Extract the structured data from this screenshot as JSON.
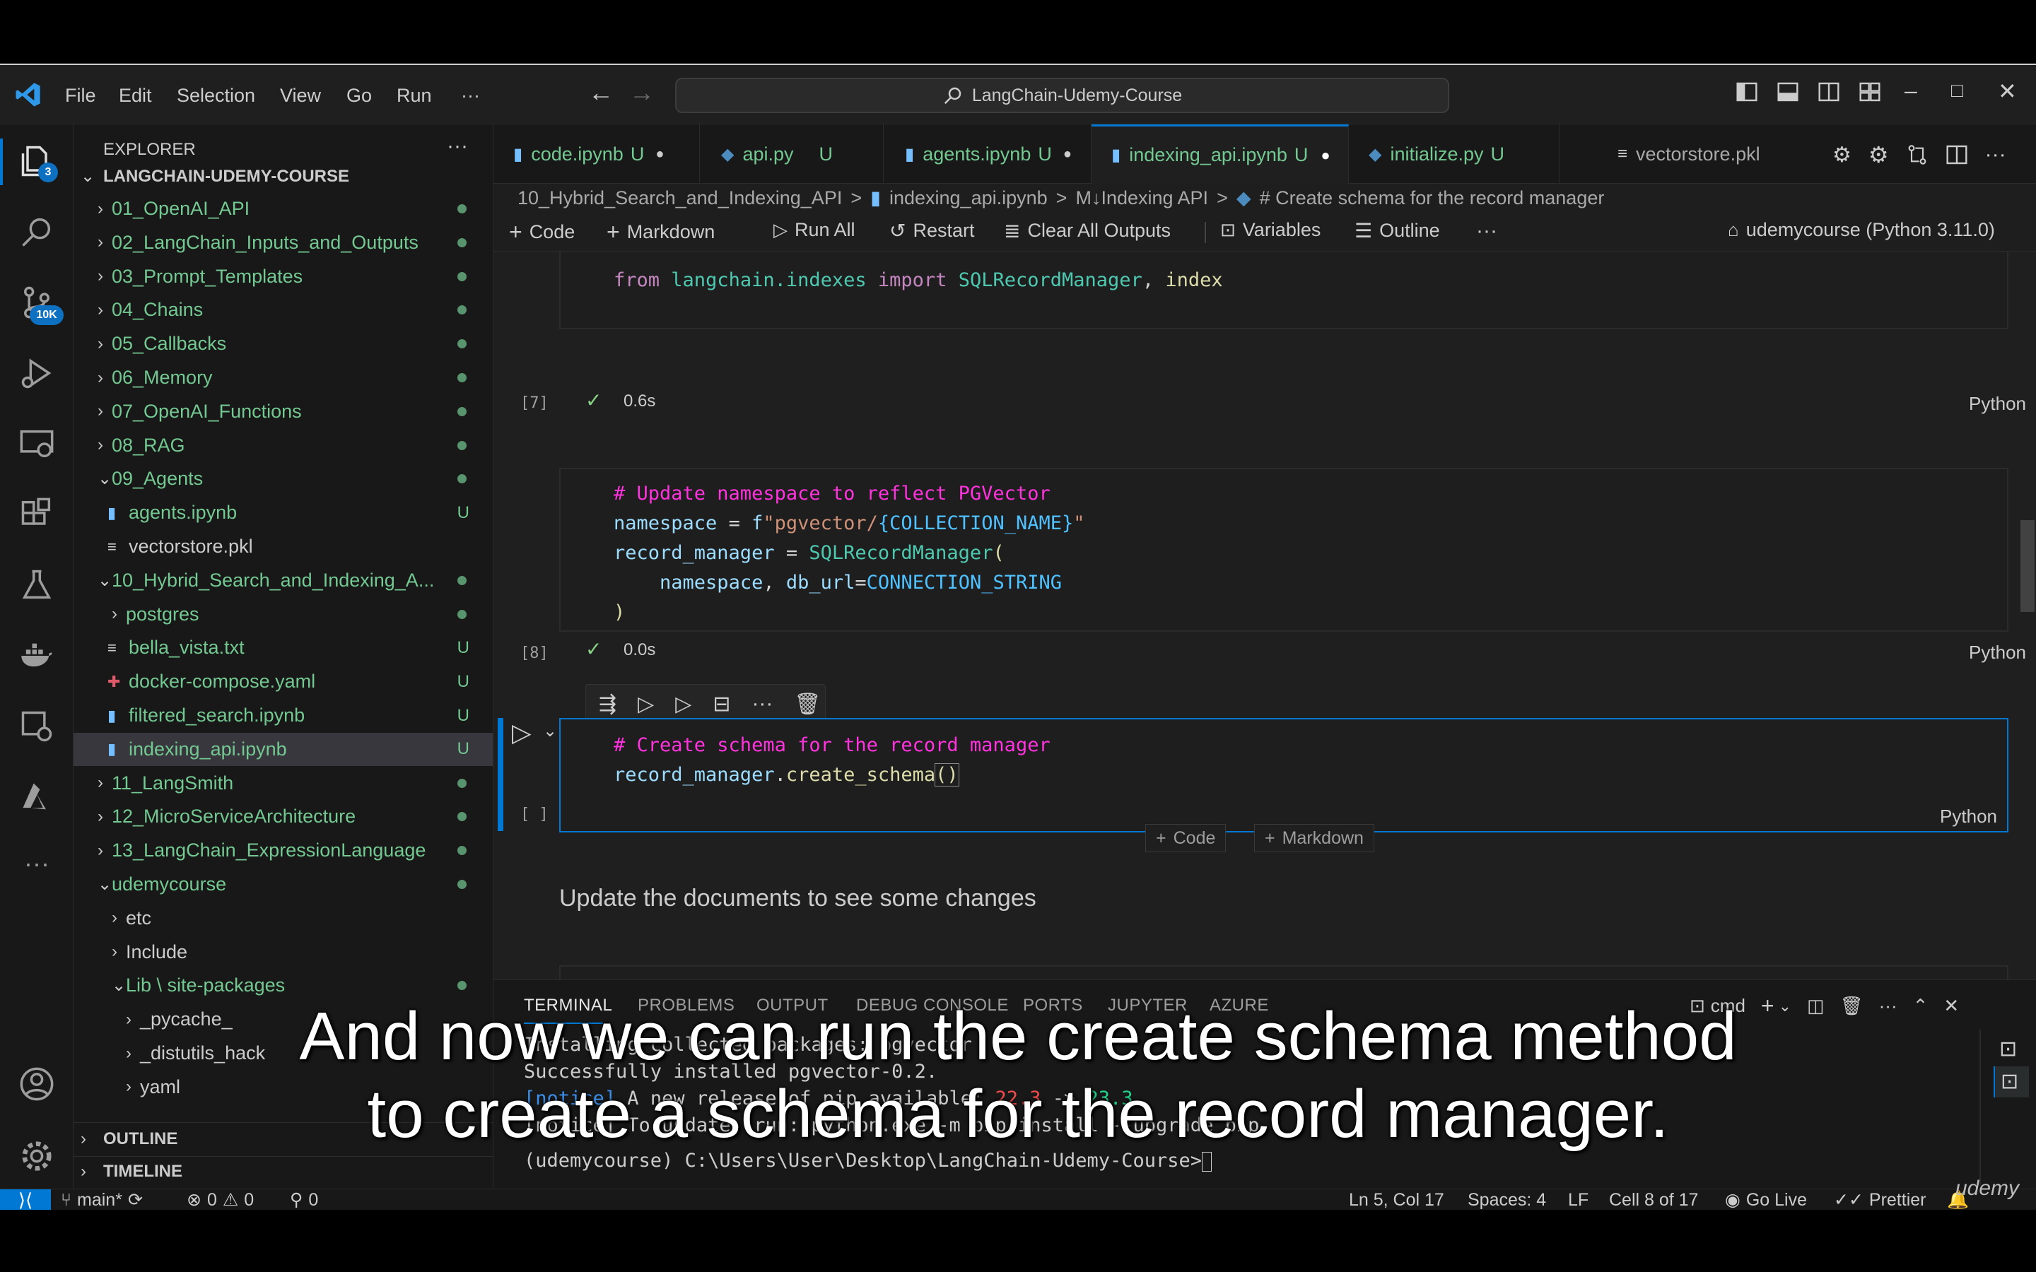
{
  "menu": [
    "File",
    "Edit",
    "Selection",
    "View",
    "Go",
    "Run",
    "···"
  ],
  "search": {
    "text": "LangChain-Udemy-Course"
  },
  "activity_badges": {
    "explorer": "3",
    "scm": "10K"
  },
  "sidebar": {
    "header": "EXPLORER",
    "root": "LANGCHAIN-UDEMY-COURSE",
    "items": [
      {
        "label": "01_OpenAI_API",
        "type": "folder",
        "status": "dot"
      },
      {
        "label": "02_LangChain_Inputs_and_Outputs",
        "type": "folder",
        "status": "dot"
      },
      {
        "label": "03_Prompt_Templates",
        "type": "folder",
        "status": "dot"
      },
      {
        "label": "04_Chains",
        "type": "folder",
        "status": "dot"
      },
      {
        "label": "05_Callbacks",
        "type": "folder",
        "status": "dot"
      },
      {
        "label": "06_Memory",
        "type": "folder",
        "status": "dot"
      },
      {
        "label": "07_OpenAI_Functions",
        "type": "folder",
        "status": "dot"
      },
      {
        "label": "08_RAG",
        "type": "folder",
        "status": "dot"
      },
      {
        "label": "09_Agents",
        "type": "folder-open",
        "status": "dot"
      },
      {
        "label": "agents.ipynb",
        "type": "file",
        "status": "U"
      },
      {
        "label": "vectorstore.pkl",
        "type": "file",
        "status": ""
      },
      {
        "label": "10_Hybrid_Search_and_Indexing_A...",
        "type": "folder-open",
        "status": "dot"
      },
      {
        "label": "postgres",
        "type": "folder",
        "status": "dot"
      },
      {
        "label": "bella_vista.txt",
        "type": "file",
        "status": "U"
      },
      {
        "label": "docker-compose.yaml",
        "type": "file",
        "status": "U"
      },
      {
        "label": "filtered_search.ipynb",
        "type": "file",
        "status": "U"
      },
      {
        "label": "indexing_api.ipynb",
        "type": "file",
        "status": "U"
      },
      {
        "label": "11_LangSmith",
        "type": "folder",
        "status": "dot"
      },
      {
        "label": "12_MicroServiceArchitecture",
        "type": "folder",
        "status": "dot"
      },
      {
        "label": "13_LangChain_ExpressionLanguage",
        "type": "folder",
        "status": "dot"
      },
      {
        "label": "udemycourse",
        "type": "folder-open",
        "status": "dot"
      },
      {
        "label": "etc",
        "type": "folder",
        "status": ""
      },
      {
        "label": "Include",
        "type": "folder",
        "status": ""
      },
      {
        "label": "Lib \\ site-packages",
        "type": "folder-open",
        "status": "dot"
      },
      {
        "label": "_pycache_",
        "type": "folder",
        "status": ""
      },
      {
        "label": "_distutils_hack",
        "type": "folder",
        "status": ""
      },
      {
        "label": "yaml",
        "type": "folder",
        "status": ""
      }
    ],
    "outline": "OUTLINE",
    "timeline": "TIMELINE"
  },
  "tabs": [
    {
      "label": "code.ipynb",
      "status": "U",
      "dirty": "●"
    },
    {
      "label": "api.py",
      "status": "U",
      "dirty": ""
    },
    {
      "label": "agents.ipynb",
      "status": "U",
      "dirty": "●"
    },
    {
      "label": "indexing_api.ipynb",
      "status": "U",
      "dirty": "●"
    },
    {
      "label": "initialize.py",
      "status": "U",
      "dirty": ""
    },
    {
      "label": "vectorstore.pkl",
      "status": "",
      "dirty": ""
    }
  ],
  "breadcrumb": [
    "10_Hybrid_Search_and_Indexing_API",
    ">",
    "indexing_api.ipynb",
    ">",
    "M↓Indexing API",
    ">",
    "# Create schema for the record manager"
  ],
  "toolbar": {
    "code": "Code",
    "markdown": "Markdown",
    "run_all": "Run All",
    "restart": "Restart",
    "clear": "Clear All Outputs",
    "variables": "Variables",
    "outline": "Outline",
    "more": "···",
    "kernel": "udemycourse (Python 3.11.0)"
  },
  "cells": [
    {
      "exec": "[7]",
      "time": "0.6s",
      "lang": "Python"
    },
    {
      "exec": "[8]",
      "time": "0.0s",
      "lang": "Python"
    },
    {
      "exec": "[ ]",
      "time": "",
      "lang": "Python"
    }
  ],
  "code": {
    "c1": {
      "from": "from",
      "mod": "langchain.indexes",
      "imp": "import",
      "a": "SQLRecordManager",
      "comma": ",",
      "b": "index"
    },
    "c2": {
      "comment": "# Update namespace to reflect PGVector",
      "l2a": "namespace",
      "l2b": " = ",
      "l2c": "f",
      "l2d": "\"pgvector/",
      "l2e": "{COLLECTION_NAME}",
      "l2f": "\"",
      "l3a": "record_manager",
      "l3b": " = ",
      "l3c": "SQLRecordManager",
      "l3d": "(",
      "l4a": "namespace",
      "l4b": ", ",
      "l4c": "db_url",
      "l4d": "=",
      "l4e": "CONNECTION_STRING",
      "l5": ")"
    },
    "c3": {
      "comment": "# Create schema for the record manager",
      "l2a": "record_manager",
      "l2b": ".",
      "l2c": "create_schema",
      "l2d": "()"
    }
  },
  "add_cell": {
    "code": "Code",
    "markdown": "Markdown"
  },
  "markdown_text": "Update the documents to see some changes",
  "panel": {
    "tabs": [
      "TERMINAL",
      "PROBLEMS",
      "OUTPUT",
      "DEBUG CONSOLE",
      "PORTS",
      "JUPYTER",
      "AZURE"
    ],
    "shell": "cmd",
    "lines": [
      "Installing collected packages: pgvector",
      "Successfully installed pgvector-0.2.",
      "",
      "[notice] A new release of pip available: 22.3 -> 23.3",
      "[notice] To update, run: python.exe -m pip install --upgrade pip",
      "",
      "(udemycourse) C:\\Users\\User\\Desktop\\LangChain-Udemy-Course>"
    ],
    "notice_tag": "[notice]",
    "notice_text": " A new release of pip available: ",
    "old_ver": "22.3",
    "arrow": " -> ",
    "new_ver": "23.3"
  },
  "status": {
    "branch": "main*",
    "errors": "0",
    "warnings": "0",
    "ports": "0",
    "position": "Ln 5, Col 17",
    "spaces": "Spaces: 4",
    "eol": "LF",
    "cell": "Cell 8 of 17",
    "golive": "Go Live",
    "prettier": "Prettier"
  },
  "watermark": "udemy",
  "caption": {
    "line1": "And now we can run the create schema method",
    "line2": "to create a schema for the record manager."
  },
  "colors": {
    "accent": "#0078d4",
    "untracked": "#73c991",
    "comment": "#ff33dd",
    "keyword": "#c586c0"
  }
}
